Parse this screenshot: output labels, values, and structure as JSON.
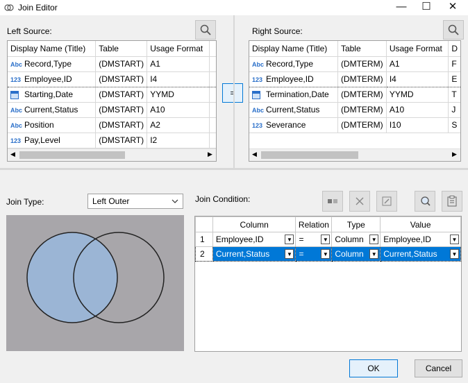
{
  "window": {
    "title": "Join Editor",
    "minimize": "—",
    "maximize": "☐",
    "close": "✕"
  },
  "left_source": {
    "label": "Left Source:",
    "columns": [
      "Display Name (Title)",
      "Table",
      "Usage Format"
    ],
    "rows": [
      {
        "icon": "Abc",
        "name": "Record,Type",
        "table": "(DMSTART)",
        "format": "A1"
      },
      {
        "icon": "123",
        "name": "Employee,ID",
        "table": "(DMSTART)",
        "format": "I4"
      },
      {
        "icon": "cal",
        "name": "Starting,Date",
        "table": "(DMSTART)",
        "format": "YYMD"
      },
      {
        "icon": "Abc",
        "name": "Current,Status",
        "table": "(DMSTART)",
        "format": "A10"
      },
      {
        "icon": "Abc",
        "name": "Position",
        "table": "(DMSTART)",
        "format": "A2"
      },
      {
        "icon": "123",
        "name": "Pay,Level",
        "table": "(DMSTART)",
        "format": "I2"
      }
    ]
  },
  "right_source": {
    "label": "Right Source:",
    "columns": [
      "Display Name (Title)",
      "Table",
      "Usage Format",
      "D"
    ],
    "rows": [
      {
        "icon": "Abc",
        "name": "Record,Type",
        "table": "(DMTERM)",
        "format": "A1",
        "extra": "F"
      },
      {
        "icon": "123",
        "name": "Employee,ID",
        "table": "(DMTERM)",
        "format": "I4",
        "extra": "E"
      },
      {
        "icon": "cal",
        "name": "Termination,Date",
        "table": "(DMTERM)",
        "format": "YYMD",
        "extra": "T"
      },
      {
        "icon": "Abc",
        "name": "Current,Status",
        "table": "(DMTERM)",
        "format": "A10",
        "extra": "J"
      },
      {
        "icon": "123",
        "name": "Severance",
        "table": "(DMTERM)",
        "format": "I10",
        "extra": "S"
      }
    ]
  },
  "equals_button": "=",
  "join_type": {
    "label": "Join Type:",
    "value": "Left Outer"
  },
  "join_condition": {
    "label": "Join Condition:",
    "columns": [
      "Column",
      "Relation",
      "Type",
      "Value"
    ],
    "rows": [
      {
        "num": "1",
        "column": "Employee,ID",
        "relation": "=",
        "type": "Column",
        "value": "Employee,ID"
      },
      {
        "num": "2",
        "column": "Current,Status",
        "relation": "=",
        "type": "Column",
        "value": "Current,Status"
      }
    ]
  },
  "buttons": {
    "ok": "OK",
    "cancel": "Cancel"
  },
  "colors": {
    "venn_bg": "#a8a6aa",
    "venn_fill": "#9bb5d5",
    "selection": "#0078d7"
  }
}
